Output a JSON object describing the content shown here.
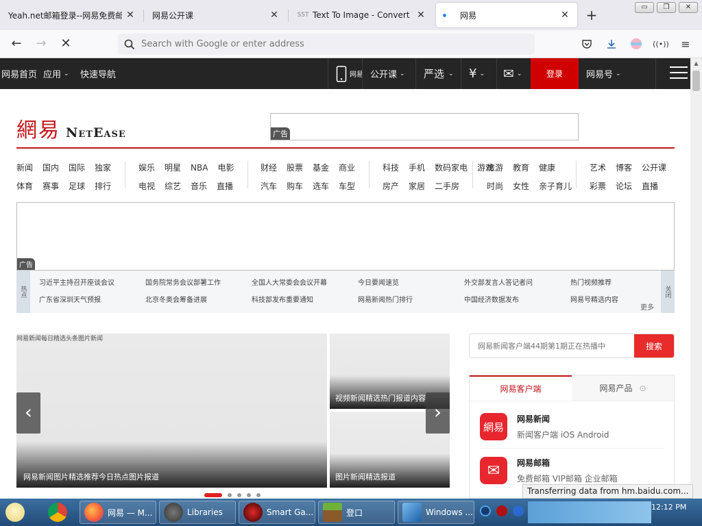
{
  "browser": {
    "tabs": [
      {
        "title": "Yeah.net邮箱登录--网易免费邮",
        "active": false
      },
      {
        "title": "网易公开课",
        "active": false
      },
      {
        "title": "Text To Image - Convert Your",
        "favicon": "SST",
        "active": false
      },
      {
        "title": "网易",
        "active": true,
        "loading": true
      }
    ],
    "new_tab": "+",
    "url_placeholder": "Search with Google or enter address"
  },
  "page": {
    "topnav": {
      "left_items": [
        "网易首页",
        "应用",
        "快速导航"
      ],
      "right_items": [
        "网易",
        "公开课",
        "严选",
        "¥",
        "✉",
        "登录",
        "网易号"
      ],
      "highlight_label": "登录"
    },
    "logo": {
      "cn": "網易",
      "en": "NetEase"
    },
    "ad_label": "广告",
    "channels": [
      {
        "row1": [
          "新闻",
          "国内",
          "国际",
          "独家"
        ],
        "row2": [
          "体育",
          "赛事",
          "足球",
          "排行"
        ]
      },
      {
        "row1": [
          "娱乐",
          "明星",
          "NBA",
          "电影"
        ],
        "row2": [
          "电视",
          "综艺",
          "音乐",
          "直播"
        ]
      },
      {
        "row1": [
          "财经",
          "股票",
          "基金",
          "商业"
        ],
        "row2": [
          "汽车",
          "购车",
          "选车",
          "车型"
        ]
      },
      {
        "row1": [
          "科技",
          "手机",
          "数码家电",
          "游戏"
        ],
        "row2": [
          "房产",
          "家居",
          "二手房"
        ]
      },
      {
        "row1": [
          "旅游",
          "教育",
          "健康"
        ],
        "row2": [
          "时尚",
          "女性",
          "亲子育儿"
        ]
      },
      {
        "row1": [
          "艺术",
          "博客",
          "公开课"
        ],
        "row2": [
          "彩票",
          "论坛",
          "直播"
        ]
      }
    ],
    "ad_banner_label": "广告",
    "hotbar": {
      "left_edge": "热点",
      "right_edge": "关闭",
      "columns": [
        [
          "习近平主持召开座谈会议",
          "广东省深圳天气预报"
        ],
        [
          "国务院常务会议部署工作",
          "北京冬奥会筹备进展"
        ],
        [
          "全国人大常委会会议开幕",
          "科技部发布重要通知"
        ],
        [
          "今日要闻速览",
          "网易新闻热门排行"
        ],
        [
          "外交部发言人答记者问",
          "中国经济数据发布"
        ],
        [
          "热门视频推荐",
          "网易号精选内容"
        ]
      ],
      "more_label": "更多"
    },
    "slider": {
      "main_top_caption": "网易新闻每日精选头条图片新闻",
      "main_caption": "网易新闻图片精选推荐今日热点图片报道",
      "right1_caption": "视频新闻精选热门报道内容",
      "right2_caption": "图片新闻精选报道",
      "dots": 5,
      "active_dot": 0
    },
    "search": {
      "placeholder": "网易新闻客户端44期第1期正在热播中",
      "button_label": "搜索"
    },
    "apps": {
      "tabs": [
        "网易客户端",
        "网易产品"
      ],
      "items": [
        {
          "icon_text": "網易",
          "name": "网易新闻",
          "desc_cn": "新闻客户端",
          "platforms": "iOS   Android"
        },
        {
          "icon_text": "✉",
          "name": "网易邮箱",
          "desc_cn": "免费邮箱",
          "vip": "VIP邮箱",
          "extra": "企业邮箱"
        }
      ]
    },
    "status_popup": "Transferring data from hm.baidu.com..."
  },
  "taskbar": {
    "items": [
      {
        "label": "",
        "type": "start-avatar"
      },
      {
        "label": "",
        "type": "chrome"
      },
      {
        "label": "网易 — M...",
        "type": "firefox"
      },
      {
        "label": "Libraries",
        "type": "libraries"
      },
      {
        "label": "Smart Ga...",
        "type": "smartgame"
      },
      {
        "label": "登口",
        "type": "minecraft"
      },
      {
        "label": "Windows ...",
        "type": "windows"
      }
    ],
    "clock": "12:12 PM"
  },
  "colors": {
    "brand_red": "#c4161c",
    "hot_red": "#d10000",
    "nav_dark": "#252525",
    "search_button": "#e82b2b"
  }
}
